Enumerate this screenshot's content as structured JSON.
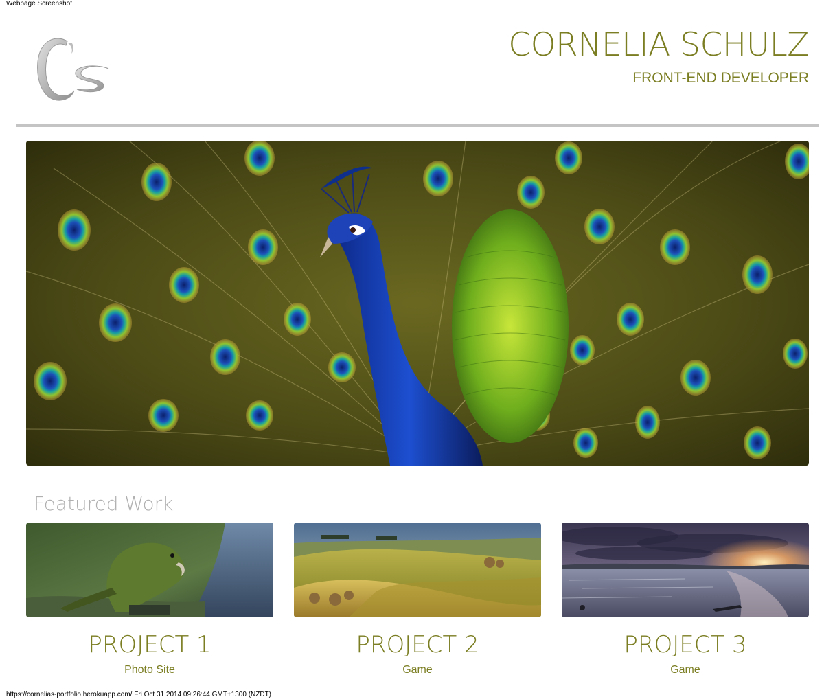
{
  "capture": {
    "label": "Webpage Screenshot",
    "footer": "https://cornelias-portfolio.herokuapp.com/ Fri Oct 31 2014 09:26:44 GMT+1300 (NZDT)"
  },
  "header": {
    "logo_text": "Cs",
    "name": "CORNELIA SCHULZ",
    "role": "FRONT-END DEVELOPER"
  },
  "hero": {
    "image": "peacock-hero-image"
  },
  "featured": {
    "heading": "Featured Work",
    "projects": [
      {
        "title": "PROJECT 1",
        "subtitle": "Photo Site",
        "image": "kea-parrot-thumbnail"
      },
      {
        "title": "PROJECT 2",
        "subtitle": "Game",
        "image": "rolling-hills-thumbnail"
      },
      {
        "title": "PROJECT 3",
        "subtitle": "Game",
        "image": "beach-sunset-thumbnail"
      }
    ]
  },
  "colors": {
    "accent": "#7b7e22",
    "heading_gray": "#b0b0b0",
    "divider": "#c4c4c4"
  }
}
